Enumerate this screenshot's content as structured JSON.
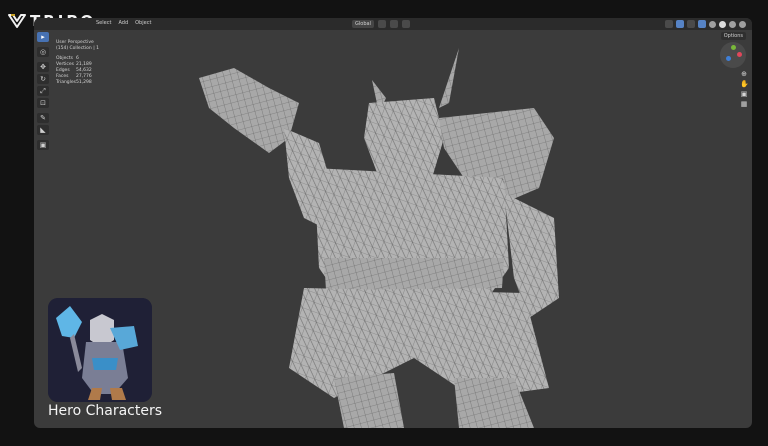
{
  "brand": {
    "name": "TRIPO",
    "mark_icon": "tripo-logo-icon"
  },
  "header": {
    "menus": [
      "Select",
      "Add",
      "Object"
    ],
    "orientation": "Global",
    "options_label": "Options"
  },
  "toolbar": {
    "icons": [
      "select-icon",
      "cursor-icon",
      "move-icon",
      "rotate-icon",
      "scale-icon",
      "transform-icon",
      "annotate-icon",
      "measure-icon",
      "add-cube-icon"
    ]
  },
  "overlay": {
    "view_name": "User Perspective",
    "collection": "(154) Collection | 1",
    "stats": [
      {
        "label": "Objects",
        "value": "6"
      },
      {
        "label": "Vertices",
        "value": "21,189"
      },
      {
        "label": "Edges",
        "value": "54,632"
      },
      {
        "label": "Faces",
        "value": "27,776"
      },
      {
        "label": "Triangles",
        "value": "51,298"
      }
    ]
  },
  "showcase": {
    "caption": "Hero Characters",
    "thumbnail": "hero-thumbnail"
  },
  "colors": {
    "viewport": "#3b3b3b",
    "accent": "#4772b3",
    "background": "#121212"
  }
}
